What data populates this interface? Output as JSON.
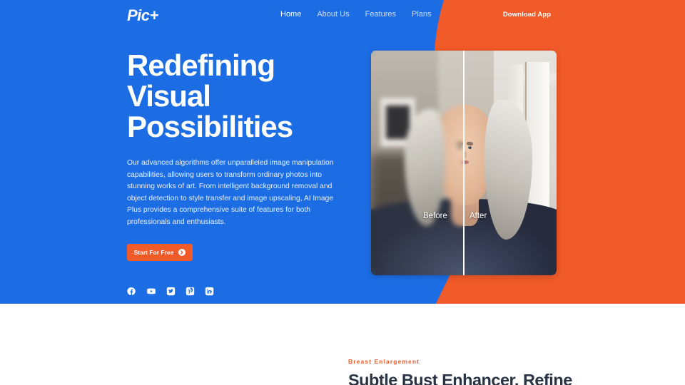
{
  "brand": {
    "logo_text": "Pic+"
  },
  "nav": {
    "items": [
      {
        "label": "Home",
        "active": true
      },
      {
        "label": "About Us",
        "active": false
      },
      {
        "label": "Features",
        "active": false
      },
      {
        "label": "Plans",
        "active": false
      }
    ],
    "download_button": "Download App"
  },
  "hero": {
    "headline_line1": "Redefining",
    "headline_line2": "Visual",
    "headline_line3": "Possibilities",
    "paragraph": "Our advanced algorithms offer unparalleled image manipulation capabilities, allowing users to transform ordinary photos into stunning works of art. From intelligent background removal and object detection to style transfer and image upscaling, AI Image Plus provides a comprehensive suite of features for both professionals and enthusiasts.",
    "cta_label": "Start For Free",
    "socials": [
      {
        "name": "facebook-icon",
        "label": "Facebook"
      },
      {
        "name": "youtube-icon",
        "label": "YouTube"
      },
      {
        "name": "twitter-icon",
        "label": "Twitter"
      },
      {
        "name": "pinterest-icon",
        "label": "Pinterest"
      },
      {
        "name": "linkedin-icon",
        "label": "LinkedIn"
      }
    ],
    "comparison": {
      "before_label": "Before",
      "after_label": "After",
      "image_alt": "Portrait of a woman with long silver-gray hair wearing a navy top, blurred on the left half and sharpened on the right half"
    }
  },
  "section2": {
    "eyebrow": "Breast Enlargement",
    "title": "Subtle Bust Enhancer, Refine"
  },
  "colors": {
    "brand_blue": "#1C6DE4",
    "accent_orange": "#F15A29",
    "heading_dark": "#2A3344",
    "white": "#FFFFFF"
  }
}
